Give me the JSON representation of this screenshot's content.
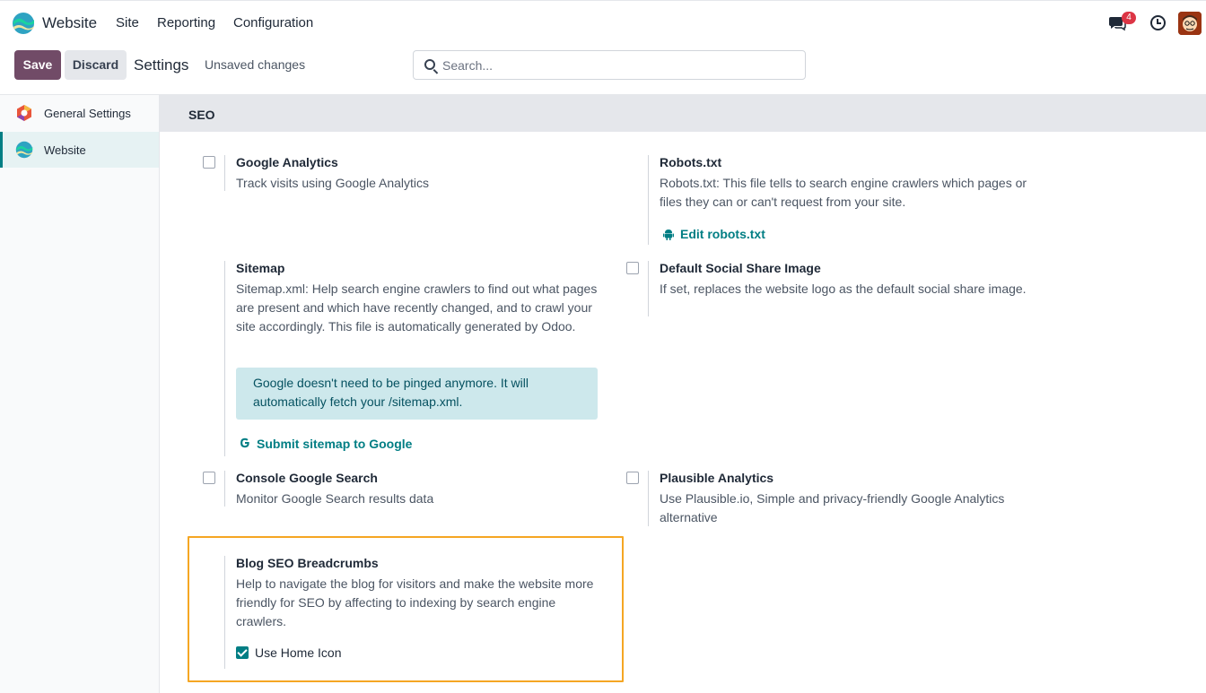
{
  "navbar": {
    "app_name": "Website",
    "menu": [
      "Site",
      "Reporting",
      "Configuration"
    ],
    "chat_badge": "4"
  },
  "control": {
    "save_label": "Save",
    "discard_label": "Discard",
    "title": "Settings",
    "status": "Unsaved changes",
    "search_placeholder": "Search..."
  },
  "sidebar": {
    "items": [
      {
        "label": "General Settings"
      },
      {
        "label": "Website"
      }
    ]
  },
  "section": {
    "title": "SEO"
  },
  "settings": {
    "google_analytics": {
      "title": "Google Analytics",
      "desc": "Track visits using Google Analytics"
    },
    "robots": {
      "title": "Robots.txt",
      "desc": "Robots.txt: This file tells to search engine crawlers which pages or files they can or can't request from your site.",
      "link": "Edit robots.txt"
    },
    "sitemap": {
      "title": "Sitemap",
      "desc": "Sitemap.xml: Help search engine crawlers to find out what pages are present and which have recently changed, and to crawl your site accordingly. This file is automatically generated by Odoo.",
      "alert": "Google doesn't need to be pinged anymore. It will automatically fetch your /sitemap.xml.",
      "link": "Submit sitemap to Google"
    },
    "social_image": {
      "title": "Default Social Share Image",
      "desc": "If set, replaces the website logo as the default social share image."
    },
    "console_search": {
      "title": "Console Google Search",
      "desc": "Monitor Google Search results data"
    },
    "plausible": {
      "title": "Plausible Analytics",
      "desc": "Use Plausible.io, Simple and privacy-friendly Google Analytics alternative"
    },
    "blog_breadcrumbs": {
      "title": "Blog SEO Breadcrumbs",
      "desc": "Help to navigate the blog for visitors and make the website more friendly for SEO by affecting to indexing by search engine crawlers.",
      "option_label": "Use Home Icon",
      "option_checked": true
    }
  },
  "colors": {
    "brand": "#714b67",
    "accent": "#017e84",
    "highlight": "#f5a623"
  }
}
